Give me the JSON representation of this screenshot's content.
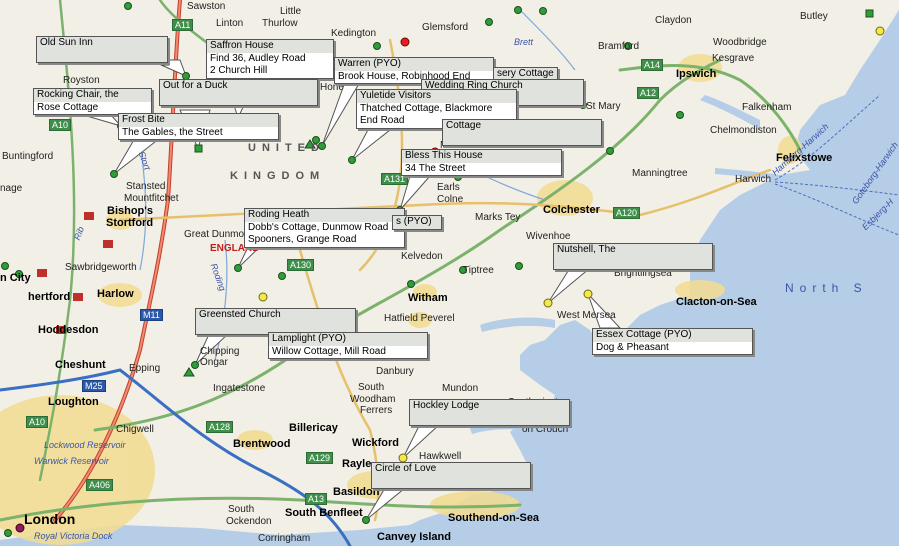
{
  "map": {
    "towns": [
      {
        "name": "Sawston",
        "cls": ""
      },
      {
        "name": "Linton",
        "cls": ""
      },
      {
        "name": "Little",
        "cls": ""
      },
      {
        "name": "Thurlow",
        "cls": ""
      },
      {
        "name": "Kedington",
        "cls": ""
      },
      {
        "name": "Glemsford",
        "cls": ""
      },
      {
        "name": "Claydon",
        "cls": ""
      },
      {
        "name": "Butley",
        "cls": ""
      },
      {
        "name": "Bramford",
        "cls": ""
      },
      {
        "name": "Woodbridge",
        "cls": ""
      },
      {
        "name": "Kesgrave",
        "cls": ""
      },
      {
        "name": "Ipswich",
        "cls": "big"
      },
      {
        "name": "Falkenham",
        "cls": ""
      },
      {
        "name": "Chelmondiston",
        "cls": ""
      },
      {
        "name": "Felixstowe",
        "cls": "big"
      },
      {
        "name": "Harwich",
        "cls": ""
      },
      {
        "name": "Manningtree",
        "cls": ""
      },
      {
        "name": "Royston",
        "cls": ""
      },
      {
        "name": "Buntingford",
        "cls": ""
      },
      {
        "name": "nage",
        "cls": ""
      },
      {
        "name": "Stansted",
        "cls": ""
      },
      {
        "name": "Mountfitchet",
        "cls": ""
      },
      {
        "name": "Bishop's",
        "cls": "big"
      },
      {
        "name": "Stortford",
        "cls": "big"
      },
      {
        "name": "Great Dunmo",
        "cls": ""
      },
      {
        "name": "Sawbridgeworth",
        "cls": ""
      },
      {
        "name": "n City",
        "cls": "big"
      },
      {
        "name": "Harlow",
        "cls": "big"
      },
      {
        "name": "hertford",
        "cls": "big"
      },
      {
        "name": "Hoddesdon",
        "cls": "big"
      },
      {
        "name": "Cheshunt",
        "cls": "big"
      },
      {
        "name": "Epping",
        "cls": ""
      },
      {
        "name": "Chipping",
        "cls": ""
      },
      {
        "name": "Ongar",
        "cls": ""
      },
      {
        "name": "Loughton",
        "cls": "big"
      },
      {
        "name": "Chigwell",
        "cls": ""
      },
      {
        "name": "Ingatestone",
        "cls": ""
      },
      {
        "name": "Brentwood",
        "cls": "big"
      },
      {
        "name": "London",
        "cls": "lon"
      },
      {
        "name": "Billericay",
        "cls": "big"
      },
      {
        "name": "Wickford",
        "cls": "big"
      },
      {
        "name": "Hawkwell",
        "cls": ""
      },
      {
        "name": "Rayle",
        "cls": "big"
      },
      {
        "name": "Basildon",
        "cls": "big"
      },
      {
        "name": "South Benfleet",
        "cls": "big"
      },
      {
        "name": "Southend-on-Sea",
        "cls": "big"
      },
      {
        "name": "Canvey Island",
        "cls": "big"
      },
      {
        "name": "South",
        "cls": ""
      },
      {
        "name": "Ockendon",
        "cls": ""
      },
      {
        "name": "Corringham",
        "cls": ""
      },
      {
        "name": "South",
        "cls": ""
      },
      {
        "name": "Woodham",
        "cls": ""
      },
      {
        "name": "Ferrers",
        "cls": ""
      },
      {
        "name": "Danbury",
        "cls": ""
      },
      {
        "name": "Mundon",
        "cls": ""
      },
      {
        "name": "Southminster",
        "cls": ""
      },
      {
        "name": "on Crouch",
        "cls": ""
      },
      {
        "name": "Hatfield Peverel",
        "cls": ""
      },
      {
        "name": "Witham",
        "cls": "big"
      },
      {
        "name": "Kelvedon",
        "cls": ""
      },
      {
        "name": "Tiptree",
        "cls": ""
      },
      {
        "name": "Marks Tey",
        "cls": ""
      },
      {
        "name": "Colchester",
        "cls": "big"
      },
      {
        "name": "Wivenhoe",
        "cls": ""
      },
      {
        "name": "Brightlingsea",
        "cls": ""
      },
      {
        "name": "Clacton-on-Sea",
        "cls": "big"
      },
      {
        "name": "West Mersea",
        "cls": ""
      },
      {
        "name": "Earls",
        "cls": ""
      },
      {
        "name": "Colne",
        "cls": ""
      },
      {
        "name": "Mount",
        "cls": ""
      },
      {
        "name": "St Mary",
        "cls": ""
      },
      {
        "name": "Hone",
        "cls": ""
      },
      {
        "name": "Brett",
        "cls": "water"
      },
      {
        "name": "Rib",
        "cls": "water"
      },
      {
        "name": "Roding",
        "cls": "water"
      },
      {
        "name": "Lockwood Reservoir",
        "cls": "water"
      },
      {
        "name": "Warwick Reservoir",
        "cls": "water"
      },
      {
        "name": "Royal Victoria Dock",
        "cls": "water"
      },
      {
        "name": "Stort",
        "cls": "water"
      },
      {
        "name": "North S",
        "cls": "sea"
      },
      {
        "name": "Hamburg-Harwich",
        "cls": "route"
      },
      {
        "name": "Goteborg-Harwich",
        "cls": "route"
      },
      {
        "name": "Esbjerg-H",
        "cls": "route"
      },
      {
        "name": "UNITED",
        "cls": "country"
      },
      {
        "name": "KINGDOM",
        "cls": "country"
      },
      {
        "name": "ENGLAND",
        "cls": "eng"
      }
    ],
    "roads": [
      {
        "name": "A11",
        "cls": ""
      },
      {
        "name": "A14",
        "cls": ""
      },
      {
        "name": "A12",
        "cls": ""
      },
      {
        "name": "A10",
        "cls": ""
      },
      {
        "name": "A131",
        "cls": ""
      },
      {
        "name": "A120",
        "cls": ""
      },
      {
        "name": "A130",
        "cls": ""
      },
      {
        "name": "M11",
        "cls": "motor"
      },
      {
        "name": "M25",
        "cls": "motor"
      },
      {
        "name": "A10",
        "cls": ""
      },
      {
        "name": "A128",
        "cls": ""
      },
      {
        "name": "A129",
        "cls": ""
      },
      {
        "name": "A13",
        "cls": ""
      },
      {
        "name": "A406",
        "cls": ""
      }
    ],
    "popups": [
      {
        "lines": [
          "Old Sun Inn",
          ""
        ]
      },
      {
        "lines": [
          "Saffron House",
          "Find 36, Audley Road",
          "2 Church Hill"
        ]
      },
      {
        "lines": [
          "Warren (PYO)",
          "Brook House, Robinhood End"
        ]
      },
      {
        "lines": [
          "sery Cottage",
          ""
        ]
      },
      {
        "lines": [
          "Wedding Ring Church",
          ""
        ]
      },
      {
        "lines": [
          "Rocking Chair, the",
          "Rose Cottage"
        ]
      },
      {
        "lines": [
          "Out for a Duck",
          ""
        ]
      },
      {
        "lines": [
          "Yuletide Visitors",
          "Thatched Cottage, Blackmore",
          "End Road"
        ]
      },
      {
        "lines": [
          "Frost Bite",
          "The Gables, the Street"
        ]
      },
      {
        "lines": [
          "Cottage",
          ""
        ]
      },
      {
        "lines": [
          "Bless This House",
          "34 The Street"
        ]
      },
      {
        "lines": [
          "Roding Heath",
          "Dobb's Cottage, Dunmow Road",
          "Spooners, Grange Road"
        ]
      },
      {
        "lines": [
          "s (PYO)"
        ]
      },
      {
        "lines": [
          "Nutshell, The",
          ""
        ]
      },
      {
        "lines": [
          "Greensted Church",
          ""
        ]
      },
      {
        "lines": [
          "Essex Cottage (PYO)",
          "Dog & Pheasant"
        ]
      },
      {
        "lines": [
          "Lamplight (PYO)",
          "Willow Cottage, Mill Road"
        ]
      },
      {
        "lines": [
          "Hockley Lodge",
          ""
        ]
      },
      {
        "lines": [
          "Circle of Love",
          ""
        ]
      }
    ]
  }
}
